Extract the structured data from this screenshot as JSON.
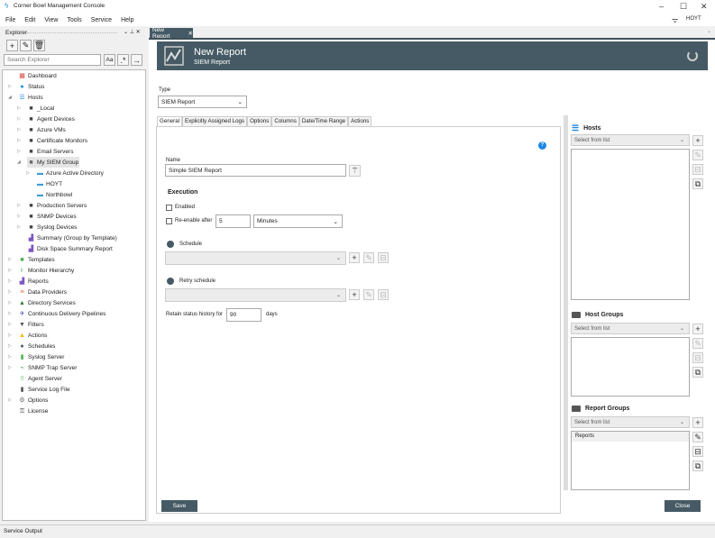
{
  "app": {
    "title": "Corner Bowl Management Console",
    "user": "HOYT"
  },
  "menu": [
    "File",
    "Edit",
    "View",
    "Tools",
    "Service",
    "Help"
  ],
  "explorer": {
    "title": "Explorer",
    "search_placeholder": "Search Explorer",
    "match_case": "Aa",
    "regex": ".*",
    "go": "→",
    "tree": [
      {
        "label": "Dashboard",
        "level": 0,
        "exp": "",
        "icon": "dashboard-icon",
        "g": "▦",
        "c": "#d9433a"
      },
      {
        "label": "Status",
        "level": 0,
        "exp": "▷",
        "icon": "status-icon",
        "g": "●",
        "c": "#1e88e5"
      },
      {
        "label": "Hosts",
        "level": 0,
        "exp": "◢",
        "icon": "hosts-icon",
        "g": "☰",
        "c": "#1e88e5"
      },
      {
        "label": "_Local",
        "level": 1,
        "exp": "▷",
        "icon": "folder-icon",
        "g": "■",
        "c": "#444"
      },
      {
        "label": "Agent Devices",
        "level": 1,
        "exp": "▷",
        "icon": "folder-icon",
        "g": "■",
        "c": "#444"
      },
      {
        "label": "Azure VMs",
        "level": 1,
        "exp": "▷",
        "icon": "folder-icon",
        "g": "■",
        "c": "#444"
      },
      {
        "label": "Certificate Monitors",
        "level": 1,
        "exp": "▷",
        "icon": "folder-icon",
        "g": "■",
        "c": "#444"
      },
      {
        "label": "Email Servers",
        "level": 1,
        "exp": "▷",
        "icon": "folder-icon",
        "g": "■",
        "c": "#444"
      },
      {
        "label": "My SIEM Group",
        "level": 1,
        "exp": "◢",
        "icon": "folder-open-icon",
        "g": "■",
        "c": "#666",
        "selected": true
      },
      {
        "label": "Azure Active Directory",
        "level": 2,
        "exp": "▷",
        "icon": "host-icon",
        "g": "▬",
        "c": "#3a9ad9"
      },
      {
        "label": "HOYT",
        "level": 2,
        "exp": "",
        "icon": "host-icon",
        "g": "▬",
        "c": "#3a9ad9"
      },
      {
        "label": "Northbowl",
        "level": 2,
        "exp": "",
        "icon": "host-icon",
        "g": "▬",
        "c": "#3a9ad9"
      },
      {
        "label": "Production Servers",
        "level": 1,
        "exp": "▷",
        "icon": "folder-icon",
        "g": "■",
        "c": "#444"
      },
      {
        "label": "SNMP Devices",
        "level": 1,
        "exp": "▷",
        "icon": "folder-icon",
        "g": "■",
        "c": "#444"
      },
      {
        "label": "Syslog Devices",
        "level": 1,
        "exp": "▷",
        "icon": "folder-icon",
        "g": "■",
        "c": "#444"
      },
      {
        "label": "Summary (Group by Template)",
        "level": 1,
        "exp": "",
        "icon": "report-icon",
        "g": "▟",
        "c": "#7e57c2"
      },
      {
        "label": "Disk Space Summary Report",
        "level": 1,
        "exp": "",
        "icon": "report-icon",
        "g": "▟",
        "c": "#7e57c2"
      },
      {
        "label": "Templates",
        "level": 0,
        "exp": "▷",
        "icon": "templates-icon",
        "g": "■",
        "c": "#4caf50"
      },
      {
        "label": "Monitor Hierarchy",
        "level": 0,
        "exp": "▷",
        "icon": "hierarchy-icon",
        "g": "⊧",
        "c": "#4caf50"
      },
      {
        "label": "Reports",
        "level": 0,
        "exp": "▷",
        "icon": "reports-icon",
        "g": "▟",
        "c": "#7e57c2"
      },
      {
        "label": "Data Providers",
        "level": 0,
        "exp": "▷",
        "icon": "database-icon",
        "g": "≡",
        "c": "#e8643c"
      },
      {
        "label": "Directory Services",
        "level": 0,
        "exp": "▷",
        "icon": "tree-icon",
        "g": "▲",
        "c": "#2e7d32"
      },
      {
        "label": "Continuous Delivery Pipelines",
        "level": 0,
        "exp": "▷",
        "icon": "pipeline-icon",
        "g": "✈",
        "c": "#3f51b5"
      },
      {
        "label": "Filters",
        "level": 0,
        "exp": "▷",
        "icon": "filter-icon",
        "g": "▼",
        "c": "#555"
      },
      {
        "label": "Actions",
        "level": 0,
        "exp": "▷",
        "icon": "warning-icon",
        "g": "▲",
        "c": "#f5b400"
      },
      {
        "label": "Schedules",
        "level": 0,
        "exp": "▷",
        "icon": "clock-icon",
        "g": "●",
        "c": "#455a64"
      },
      {
        "label": "Syslog Server",
        "level": 0,
        "exp": "▷",
        "icon": "syslog-icon",
        "g": "▮",
        "c": "#4caf50"
      },
      {
        "label": "SNMP Trap Server",
        "level": 0,
        "exp": "▷",
        "icon": "snmp-icon",
        "g": "⌁",
        "c": "#4caf50"
      },
      {
        "label": "Agent Server",
        "level": 0,
        "exp": "",
        "icon": "agent-icon",
        "g": "⇧",
        "c": "#4caf50"
      },
      {
        "label": "Service Log File",
        "level": 0,
        "exp": "",
        "icon": "log-file-icon",
        "g": "▮",
        "c": "#555"
      },
      {
        "label": "Options",
        "level": 0,
        "exp": "▷",
        "icon": "gear-icon",
        "g": "⚙",
        "c": "#666"
      },
      {
        "label": "License",
        "level": 0,
        "exp": "",
        "icon": "key-icon",
        "g": "⚿",
        "c": "#555"
      }
    ]
  },
  "doc_tab": {
    "label": "New Report",
    "close": "✕"
  },
  "header": {
    "title": "New Report",
    "subtitle": "SIEM Report"
  },
  "form": {
    "type_label": "Type",
    "type_value": "SIEM Report",
    "tabs": [
      "General",
      "Explicitly Assigned Logs",
      "Options",
      "Columns",
      "Date/Time Range",
      "Actions"
    ],
    "name_label": "Name",
    "name_value": "Simple SIEM Report",
    "execution": "Execution",
    "enabled": "Enabled",
    "reenable": "Re-enable after",
    "reenable_value": "5",
    "reenable_unit": "Minutes",
    "schedule": "Schedule",
    "retry_schedule": "Retry schedule",
    "retain_label": "Retain status history for",
    "retain_value": "90",
    "retain_unit": "days",
    "help": "?"
  },
  "right": {
    "hosts": "Hosts",
    "host_groups": "Host Groups",
    "report_groups": "Report Groups",
    "select_placeholder": "Select from list",
    "report_groups_items": [
      "Reports"
    ]
  },
  "buttons": {
    "save": "Save",
    "close": "Close"
  },
  "status_bar": "Service Output"
}
